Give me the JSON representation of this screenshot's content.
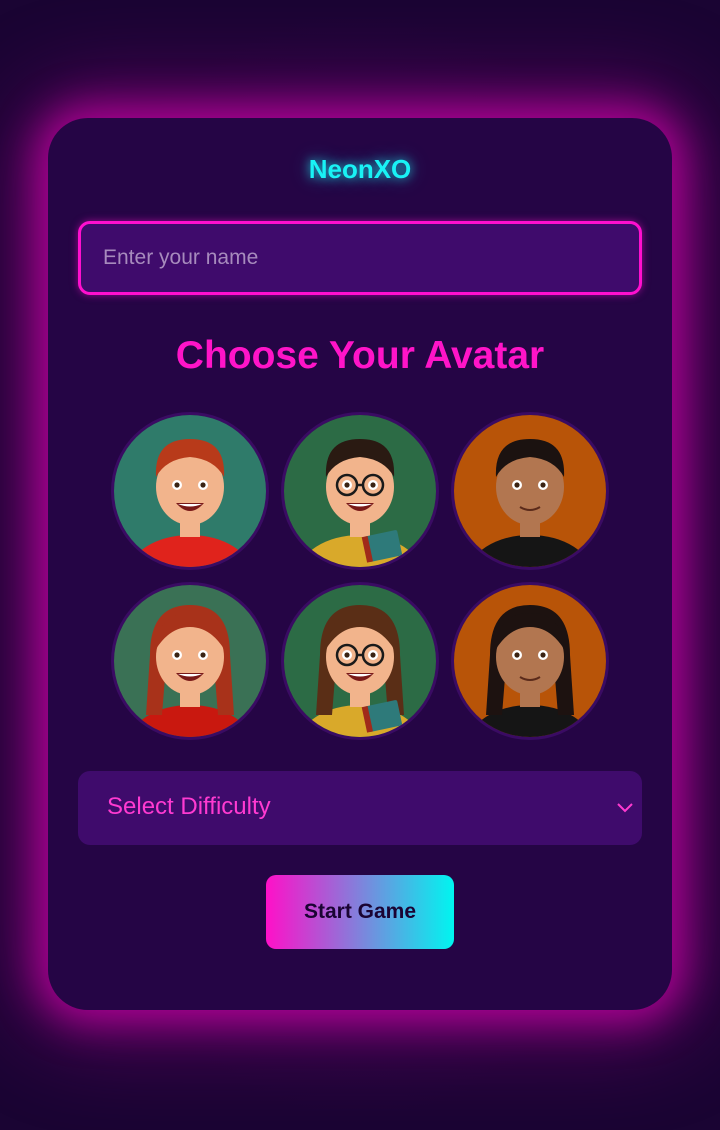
{
  "app": {
    "title": "NeonXO"
  },
  "name_input": {
    "placeholder": "Enter your name",
    "value": ""
  },
  "avatar_section": {
    "heading": "Choose Your Avatar",
    "avatars": [
      {
        "id": "avatar-boy-red-hair",
        "bg": "#2f7b6a",
        "shirt": "#e0231c",
        "hair": "#b83a1a",
        "glasses": false,
        "book": false
      },
      {
        "id": "avatar-boy-glasses-book",
        "bg": "#2c6b45",
        "shirt": "#d9a92a",
        "hair": "#2a1a12",
        "glasses": true,
        "book": true
      },
      {
        "id": "avatar-boy-black-hoodie",
        "bg": "#b85408",
        "shirt": "#151515",
        "hair": "#1b1210",
        "glasses": false,
        "book": false
      },
      {
        "id": "avatar-girl-red-hair",
        "bg": "#3a7155",
        "shirt": "#c9180f",
        "hair": "#a8321a",
        "glasses": false,
        "book": false
      },
      {
        "id": "avatar-girl-braids-glasses-book",
        "bg": "#2c6b45",
        "shirt": "#d9a92a",
        "hair": "#5a2e16",
        "glasses": true,
        "book": true
      },
      {
        "id": "avatar-girl-black-hoodie",
        "bg": "#b85408",
        "shirt": "#151515",
        "hair": "#1d1210",
        "glasses": false,
        "book": false
      }
    ]
  },
  "difficulty_select": {
    "label": "Select Difficulty"
  },
  "start_button": {
    "label": "Start Game"
  },
  "colors": {
    "accent_cyan": "#19f2f5",
    "accent_pink": "#ff14c8",
    "card_bg": "#250545",
    "field_bg": "#3f0b6c"
  }
}
